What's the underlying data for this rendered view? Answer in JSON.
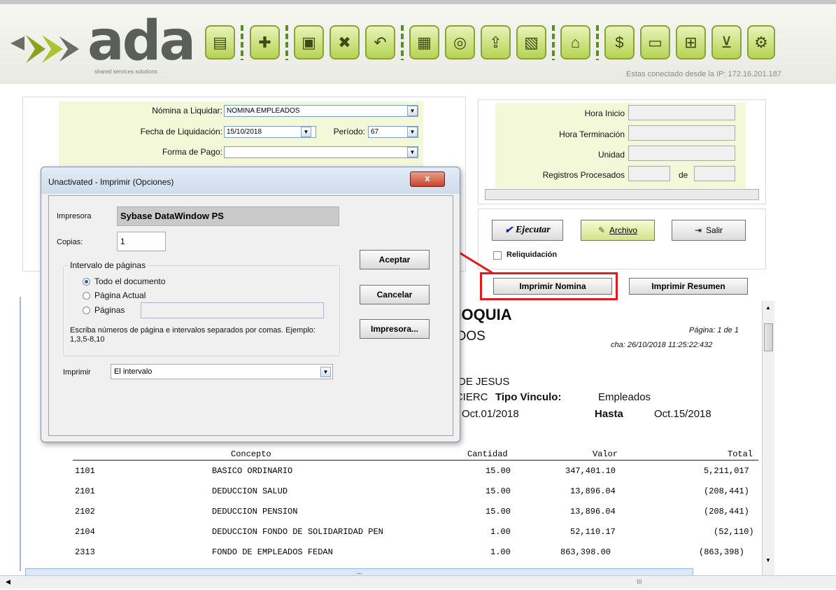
{
  "app": {
    "logo_word": "ada",
    "logo_tag": "shared services solutions",
    "ip_text": "Estas conectado desde la IP: 172.16.201.187"
  },
  "toolbar": {
    "icons": [
      "folder-icon",
      "new-doc-icon",
      "save-icon",
      "delete-icon",
      "undo-icon",
      "print-icon",
      "preview-icon",
      "export-icon",
      "box-icon",
      "lock-icon",
      "money-bag-icon",
      "report-icon",
      "grid-icon",
      "cart-icon",
      "settings-icon"
    ]
  },
  "form": {
    "nomina_label": "Nómina a Liquidar:",
    "nomina_value": "NOMINA EMPLEADOS",
    "fecha_label": "Fecha de Liquidación:",
    "fecha_value": "15/10/2018",
    "periodo_label": "Período:",
    "periodo_value": "67",
    "forma_label": "Forma de Pago:",
    "forma_value": ""
  },
  "status": {
    "hora_inicio": "Hora Inicio",
    "hora_terminacion": "Hora Terminación",
    "unidad": "Unidad",
    "registros": "Registros Procesados",
    "de": "de"
  },
  "actions": {
    "ejecutar": "Ejecutar",
    "archivo": "Archivo",
    "salir": "Salir",
    "reliquidacion": "Reliquidación",
    "imprimir_nomina": "Imprimir Nomina",
    "imprimir_resumen": "Imprimir Resumen"
  },
  "report": {
    "title_fragment": "TIOQUIA",
    "subtitle_fragment": "ADOS",
    "pagina": "Página: 1 de 1",
    "fecha": "cha: 26/10/2018 11:25:22:432",
    "line1": "D DE JESUS",
    "tipo_prefix": "NCIERC",
    "tipo_label": "Tipo Vinculo:",
    "tipo_value": "Empleados",
    "desde_value": "Oct.01/2018",
    "hasta_label": "Hasta",
    "hasta_value": "Oct.15/2018",
    "headers": {
      "concepto": "Concepto",
      "cantidad": "Cantidad",
      "valor": "Valor",
      "total": "Total"
    },
    "rows": [
      {
        "code": "1101",
        "concepto": "BASICO ORDINARIO",
        "cantidad": "15.00",
        "valor": "347,401.10",
        "total": "5,211,017"
      },
      {
        "code": "2101",
        "concepto": "DEDUCCION SALUD",
        "cantidad": "15.00",
        "valor": "13,896.04",
        "total": "(208,441)"
      },
      {
        "code": "2102",
        "concepto": "DEDUCCION PENSION",
        "cantidad": "15.00",
        "valor": "13,896.04",
        "total": "(208,441)"
      },
      {
        "code": "2104",
        "concepto": "DEDUCCION FONDO DE SOLIDARIDAD PEN",
        "cantidad": "1.00",
        "valor": "52,110.17",
        "total": "(52,110)"
      },
      {
        "code": "2313",
        "concepto": "FONDO DE EMPLEADOS FEDAN",
        "cantidad": "1.00",
        "valor": "863,398.00",
        "total": "(863,398)"
      }
    ]
  },
  "dialog": {
    "title": "Unactivated - Imprimir (Opciones)",
    "impresora_label": "Impresora",
    "impresora_value": "Sybase DataWindow PS",
    "copias_label": "Copias:",
    "copias_value": "1",
    "intervalo_label": "Intervalo de páginas",
    "todo": "Todo el documento",
    "actual": "Página Actual",
    "paginas": "Páginas",
    "help": "Escriba números de página e intervalos separados por comas. Ejemplo: 1,3,5-8,10",
    "imprimir_label": "Imprimir",
    "imprimir_value": "El intervalo",
    "aceptar": "Aceptar",
    "cancelar": "Cancelar",
    "impresora_btn": "Impresora...",
    "close": "x"
  },
  "scroll": {
    "h_grip": "...",
    "h_grip2": "III"
  },
  "colors": {
    "accent": "#8ba238",
    "highlight": "#e01b1b"
  }
}
